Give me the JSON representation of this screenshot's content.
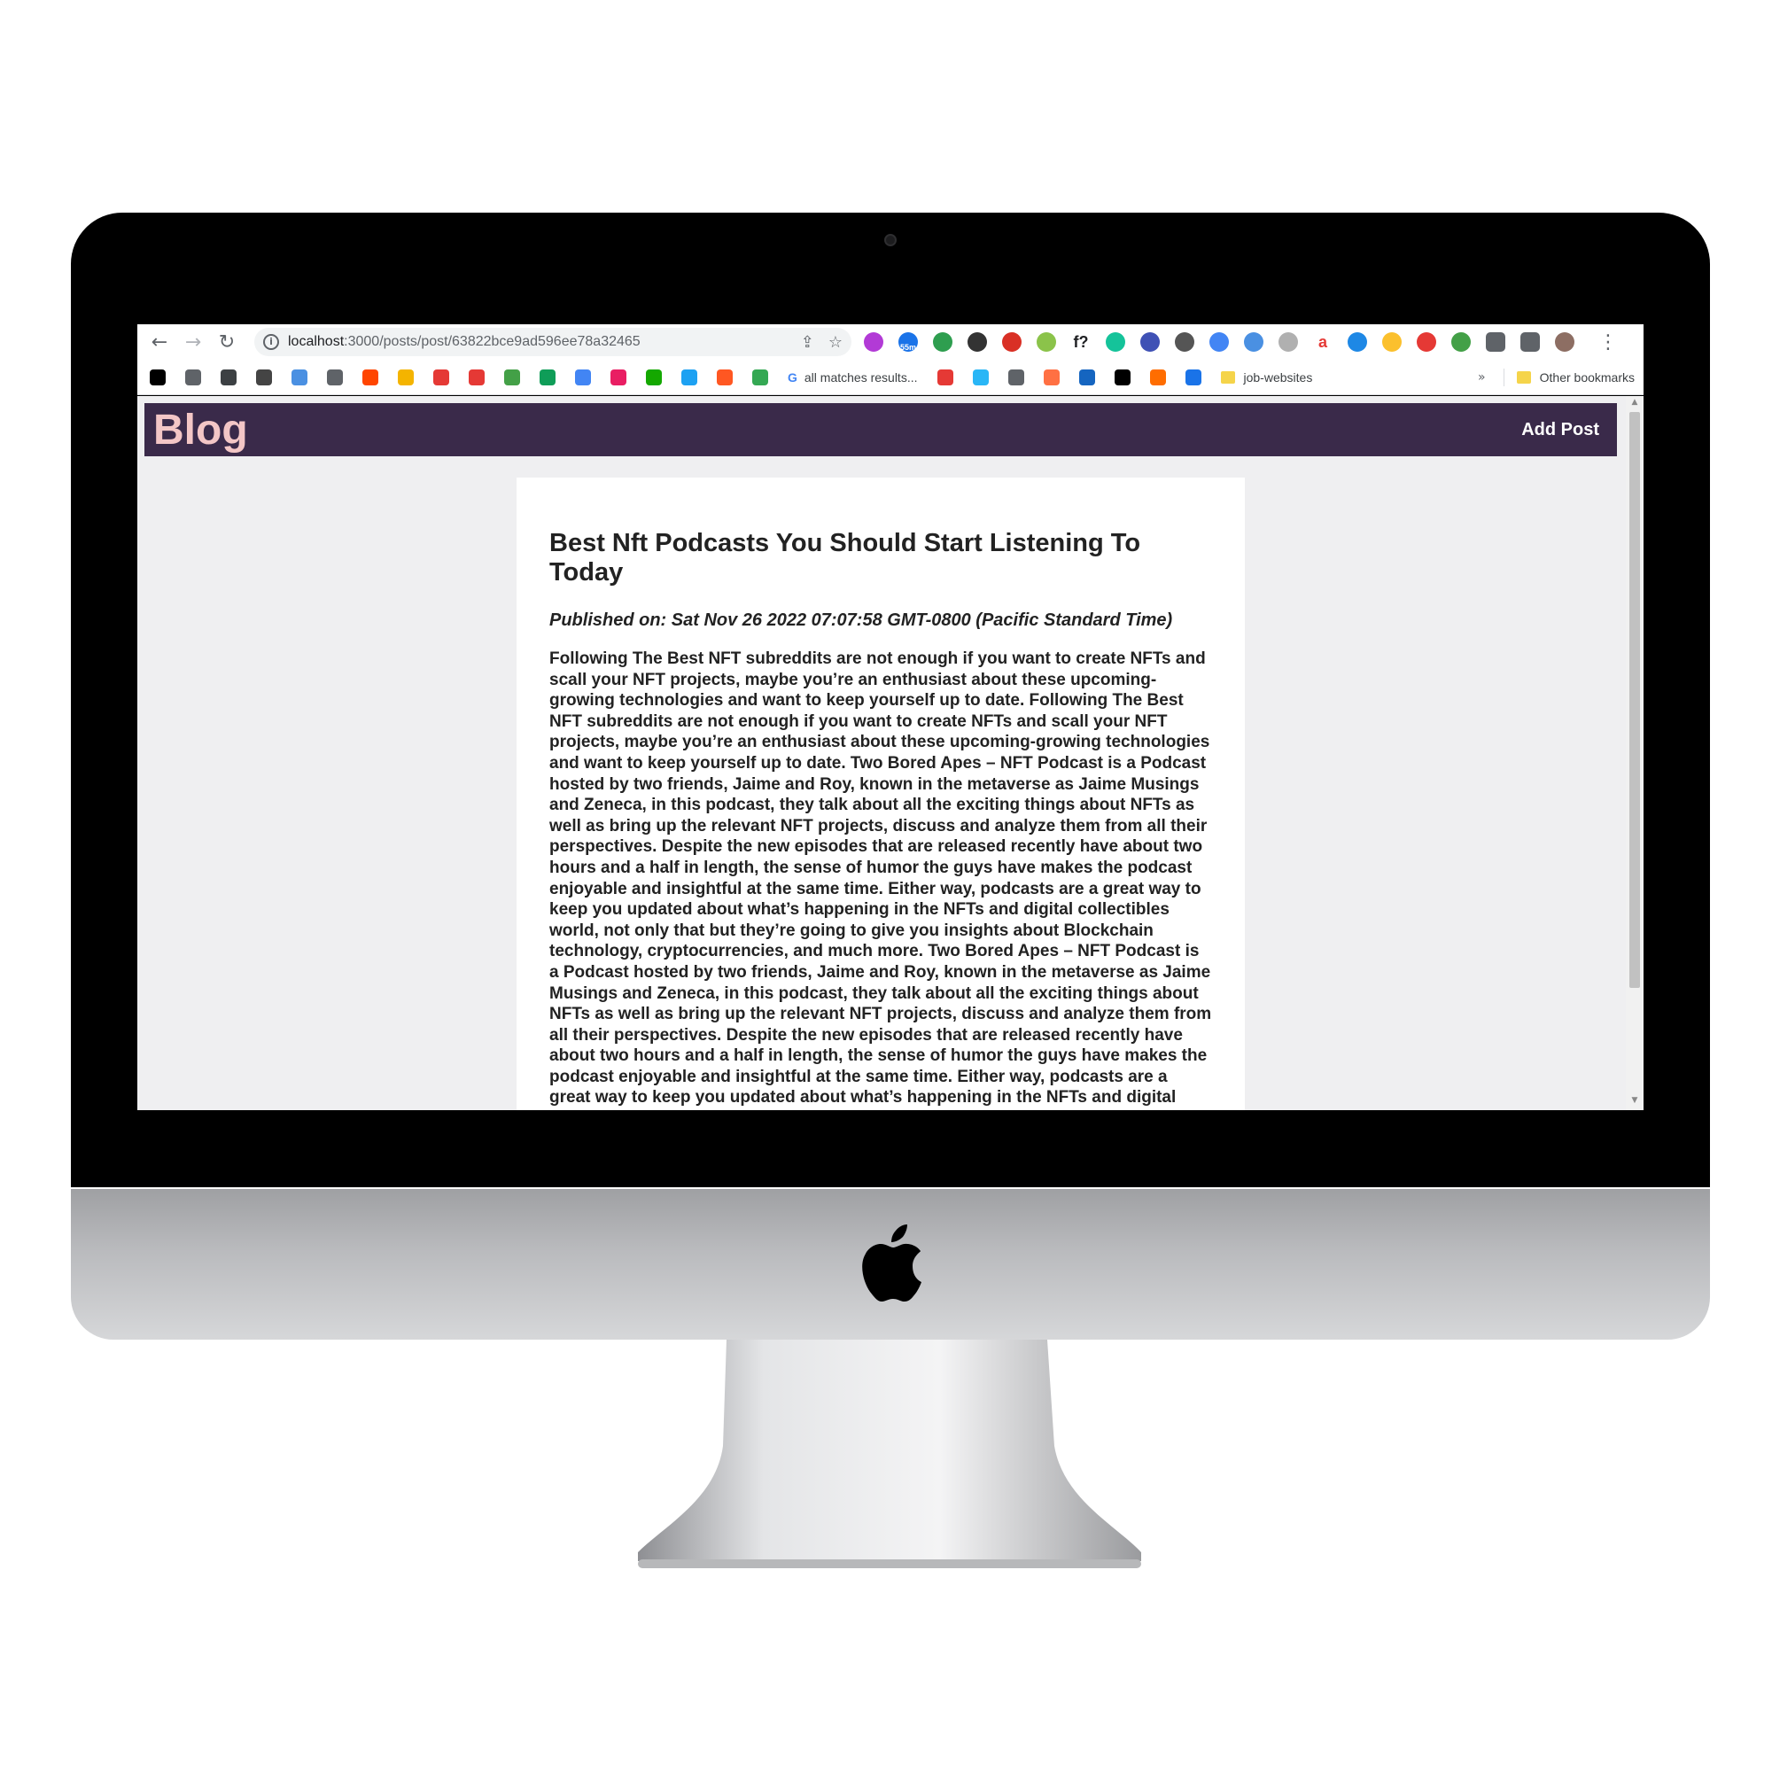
{
  "browser": {
    "url_host": "localhost",
    "url_path": ":3000/posts/post/63822bce9ad596ee78a32465",
    "extensions": [
      {
        "name": "ext-icon-1",
        "color": "#b23ad6"
      },
      {
        "name": "ext-icon-2",
        "color": "#1a73e8",
        "badge": "55m"
      },
      {
        "name": "ext-icon-3",
        "color": "#2e9e4f"
      },
      {
        "name": "ext-icon-4",
        "color": "#333333"
      },
      {
        "name": "ext-icon-5",
        "color": "#d93025"
      },
      {
        "name": "ext-icon-6",
        "color": "#8bc34a"
      },
      {
        "name": "ext-icon-7",
        "color": "#202124",
        "text": "f?"
      },
      {
        "name": "ext-icon-8",
        "color": "#15c39a"
      },
      {
        "name": "ext-icon-9",
        "color": "#3f51b5"
      },
      {
        "name": "ext-icon-10",
        "color": "#555555"
      },
      {
        "name": "ext-icon-11",
        "color": "#4285f4"
      },
      {
        "name": "ext-icon-12",
        "color": "#4a90e2"
      },
      {
        "name": "ext-icon-13",
        "color": "#b0b0b0"
      },
      {
        "name": "ext-icon-14",
        "color": "#e53935",
        "text": "a"
      },
      {
        "name": "ext-icon-15",
        "color": "#1e88e5"
      },
      {
        "name": "ext-icon-16",
        "color": "#fbc02d"
      },
      {
        "name": "ext-icon-17",
        "color": "#e53935"
      },
      {
        "name": "ext-icon-18",
        "color": "#43a047"
      },
      {
        "name": "puzzle-icon",
        "color": "#5f6368"
      },
      {
        "name": "sidepanel-icon",
        "color": "#5f6368"
      },
      {
        "name": "profile-avatar",
        "color": "#8d6e63"
      }
    ]
  },
  "bookmarks": {
    "items": [
      {
        "name": "bookmark-dev",
        "color": "#000000"
      },
      {
        "name": "bookmark-globe-1",
        "color": "#5f6368"
      },
      {
        "name": "bookmark-code",
        "color": "#3c4043"
      },
      {
        "name": "bookmark-book",
        "color": "#444444"
      },
      {
        "name": "bookmark-w",
        "color": "#4a90e2"
      },
      {
        "name": "bookmark-globe-2",
        "color": "#5f6368"
      },
      {
        "name": "bookmark-reddit",
        "color": "#ff4500"
      },
      {
        "name": "bookmark-c",
        "color": "#f4b400"
      },
      {
        "name": "bookmark-red-circle",
        "color": "#e53935"
      },
      {
        "name": "bookmark-mountain",
        "color": "#e53935"
      },
      {
        "name": "bookmark-tree",
        "color": "#43a047"
      },
      {
        "name": "bookmark-plus",
        "color": "#0f9d58"
      },
      {
        "name": "bookmark-docs",
        "color": "#4285f4"
      },
      {
        "name": "bookmark-m",
        "color": "#e91e63"
      },
      {
        "name": "bookmark-upwork",
        "color": "#14a800"
      },
      {
        "name": "bookmark-bird",
        "color": "#1da1f2"
      },
      {
        "name": "bookmark-ring",
        "color": "#ff5722"
      },
      {
        "name": "bookmark-people",
        "color": "#34a853"
      }
    ],
    "google_label": "all matches results...",
    "items2": [
      {
        "name": "bookmark-scribble",
        "color": "#e53935"
      },
      {
        "name": "bookmark-ev",
        "color": "#29b6f6"
      },
      {
        "name": "bookmark-flag",
        "color": "#5f6368"
      },
      {
        "name": "bookmark-b",
        "color": "#ff7043"
      },
      {
        "name": "bookmark-stack",
        "color": "#1565c0"
      },
      {
        "name": "bookmark-a",
        "color": "#000000"
      },
      {
        "name": "bookmark-bars",
        "color": "#ff6d00"
      },
      {
        "name": "bookmark-diamond",
        "color": "#1a73e8"
      }
    ],
    "folder_label": "job-websites",
    "more": "»",
    "other_label": "Other bookmarks"
  },
  "site": {
    "brand": "Blog",
    "add_post": "Add Post"
  },
  "post": {
    "title": "Best Nft Podcasts You Should Start Listening To Today",
    "published": "Published on: Sat Nov 26 2022 07:07:58 GMT-0800 (Pacific Standard Time)",
    "body": "Following The Best NFT subreddits are not enough if you want to create NFTs and scall your NFT projects, maybe you’re an enthusiast about these upcoming-growing technologies and want to keep yourself up to date. Following The Best NFT subreddits are not enough if you want to create NFTs and scall your NFT projects, maybe you’re an enthusiast about these upcoming-growing technologies and want to keep yourself up to date. Two Bored Apes – NFT Podcast is a Podcast hosted by two friends, Jaime and Roy, known in the metaverse as Jaime Musings and Zeneca, in this podcast, they talk about all the exciting things about NFTs as well as bring up the relevant NFT projects, discuss and analyze them from all their perspectives. Despite the new episodes that are released recently have about two hours and a half in length, the sense of humor the guys have makes the podcast enjoyable and insightful at the same time. Either way, podcasts are a great way to keep you updated about what’s happening in the NFTs and digital collectibles world, not only that but they’re going to give you insights about Blockchain technology, cryptocurrencies, and much more. Two Bored Apes – NFT Podcast is a Podcast hosted by two friends, Jaime and Roy, known in the metaverse as Jaime Musings and Zeneca, in this podcast, they talk about all the exciting things about NFTs as well as bring up the relevant NFT projects, discuss and analyze them from all their perspectives. Despite the new episodes that are released recently have about two hours and a half in length, the sense of humor the guys have makes the podcast enjoyable and insightful at the same time. Either way, podcasts are a great way to keep you updated about what’s happening in the NFTs and digital collectibles"
  }
}
